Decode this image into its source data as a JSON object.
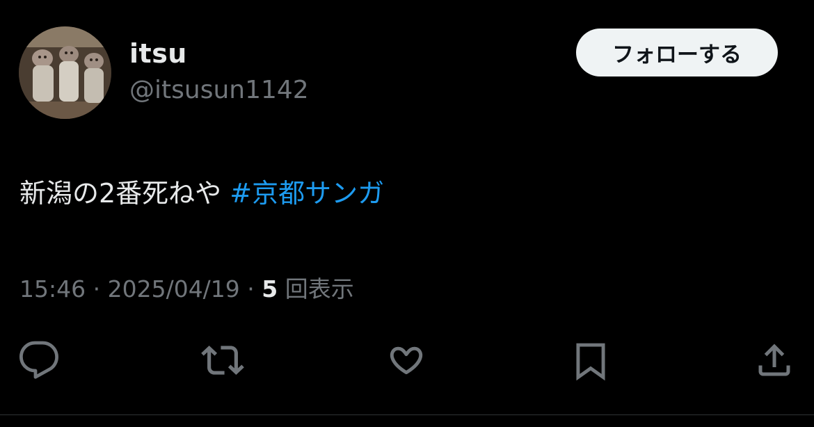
{
  "user": {
    "name": "itsu",
    "handle": "@itsusun1142",
    "follow_label": "フォローする"
  },
  "tweet": {
    "text": "新潟の2番死ねや ",
    "hashtag": "#京都サンガ",
    "time": "15:46",
    "sep1": " · ",
    "date": "2025/04/19",
    "sep2": " · ",
    "views_count": "5",
    "views_label": " 回表示"
  },
  "actions": {
    "reply": "reply-icon",
    "retweet": "retweet-icon",
    "like": "heart-icon",
    "bookmark": "bookmark-icon",
    "share": "share-icon"
  },
  "colors": {
    "background": "#000000",
    "text": "#e7e9ea",
    "secondary": "#71767b",
    "accent": "#1d9bf0",
    "button_bg": "#eff3f4"
  }
}
